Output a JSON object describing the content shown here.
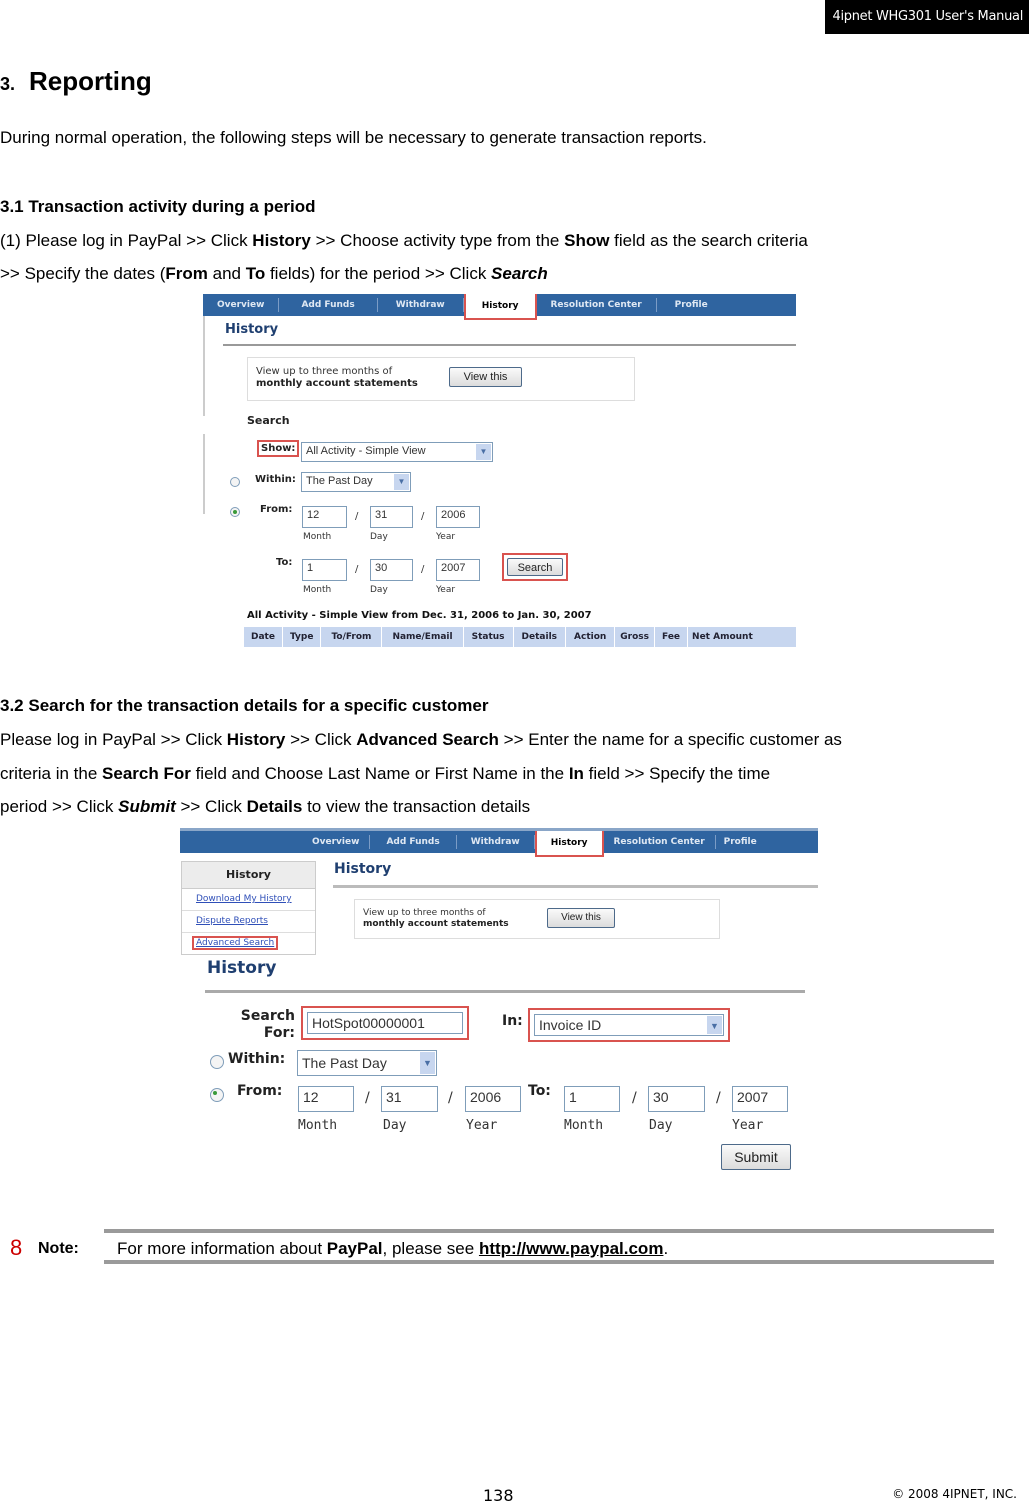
{
  "header": {
    "manual_title": "4ipnet WHG301 User's Manual"
  },
  "section": {
    "number": "3.",
    "title": "Reporting",
    "intro": "During normal operation, the following steps will be necessary to generate transaction reports."
  },
  "sub1": {
    "heading": "3.1 Transaction activity during a period",
    "line1": [
      "(1) Please log in PayPal >> Click ",
      "History",
      " >> Choose activity type from the ",
      "Show",
      " field as the search criteria"
    ],
    "line2": [
      ">> Specify the dates (",
      "From",
      " and ",
      "To",
      " fields) for the period >> Click ",
      "Search"
    ]
  },
  "screenshot1": {
    "nav_tabs": [
      "Overview",
      "Add Funds",
      "Withdraw",
      "History",
      "Resolution Center",
      "Profile"
    ],
    "active_tab": "History",
    "page_title": "History",
    "statement_text_1": "View up to three months of",
    "statement_text_2": "monthly account statements",
    "view_button": "View this",
    "search_heading": "Search",
    "show_label": "Show:",
    "show_value": "All Activity - Simple View",
    "within_label": "Within:",
    "within_value": "The Past Day",
    "from_label": "From:",
    "from": {
      "month": "12",
      "day": "31",
      "year": "2006"
    },
    "to_label": "To:",
    "to": {
      "month": "1",
      "day": "30",
      "year": "2007"
    },
    "date_caps": {
      "month": "Month",
      "day": "Day",
      "year": "Year"
    },
    "slash": "/",
    "search_button": "Search",
    "results_title": "All Activity - Simple View from Dec. 31, 2006 to Jan. 30, 2007",
    "columns": [
      "Date",
      "Type",
      "To/From",
      "Name/Email",
      "Status",
      "Details",
      "Action",
      "Gross",
      "Fee",
      "Net Amount"
    ]
  },
  "sub2": {
    "heading": "3.2 Search for the transaction details for a specific customer",
    "line1": [
      "Please log in PayPal >> Click ",
      "History",
      " >> Click ",
      "Advanced Search",
      " >> Enter the name for a specific customer as"
    ],
    "line2": [
      "criteria in the ",
      "Search For",
      " field and Choose Last Name or First Name in the ",
      "In",
      " field >> Specify the time"
    ],
    "line3": [
      "period >> Click ",
      "Submit",
      " >> Click ",
      "Details",
      " to view the transaction details"
    ]
  },
  "screenshot2": {
    "nav_tabs": [
      "Overview",
      "Add Funds",
      "Withdraw",
      "History",
      "Resolution Center",
      "Profile"
    ],
    "sidebar_title": "History",
    "sidebar_links": [
      "Download My History",
      "Dispute Reports",
      "Advanced Search"
    ],
    "page_title": "History",
    "statement_text_1": "View up to three months of",
    "statement_text_2": "monthly account statements",
    "view_button": "View this",
    "form_title": "History",
    "search_for_label_1": "Search",
    "search_for_label_2": "For:",
    "search_for_value": "HotSpot00000001",
    "in_label": "In:",
    "in_value": "Invoice ID",
    "within_label": "Within:",
    "within_value": "The Past Day",
    "from_label": "From:",
    "from": {
      "month": "12",
      "day": "31",
      "year": "2006"
    },
    "to_label": "To:",
    "to": {
      "month": "1",
      "day": "30",
      "year": "2007"
    },
    "date_caps": {
      "month": "Month",
      "day": "Day",
      "year": "Year"
    },
    "slash": "/",
    "submit_button": "Submit"
  },
  "note": {
    "icon": "8",
    "label": "Note:",
    "text_pre": "For more information about ",
    "brand": "PayPal",
    "text_mid": ", please see ",
    "link": "http://www.paypal.com",
    "text_post": "."
  },
  "footer": {
    "page_number": "138",
    "copyright": "© 2008 4IPNET, INC."
  }
}
